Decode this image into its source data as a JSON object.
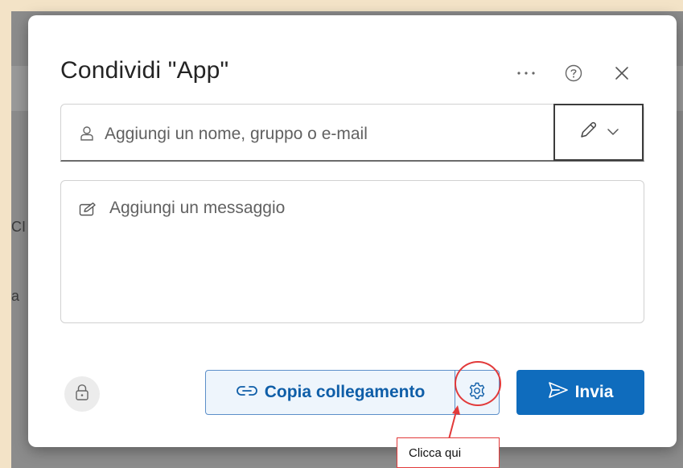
{
  "dialog": {
    "title": "Condividi \"App\"",
    "more_icon": "ellipsis-icon",
    "help_icon": "question-circle-icon",
    "close_icon": "close-icon"
  },
  "recipient": {
    "placeholder": "Aggiungi un nome, gruppo o e-mail",
    "value": "",
    "icon": "person-icon",
    "permission_icon": "pencil-icon",
    "permission_chevron": "chevron-down-icon"
  },
  "message": {
    "placeholder": "Aggiungi un messaggio",
    "value": "",
    "icon": "compose-icon"
  },
  "footer": {
    "lock_icon": "lock-icon",
    "copy_link_label": "Copia collegamento",
    "copy_link_icon": "link-icon",
    "settings_icon": "gear-icon",
    "send_label": "Invia",
    "send_icon": "send-icon"
  },
  "annotation": {
    "callout_text": "Clicca qui"
  },
  "background": {
    "left_text_1": "CI",
    "left_text_2": "a"
  },
  "colors": {
    "accent": "#0f6cbd",
    "annotation": "#e23a3a",
    "frame": "#f3e3c7"
  }
}
